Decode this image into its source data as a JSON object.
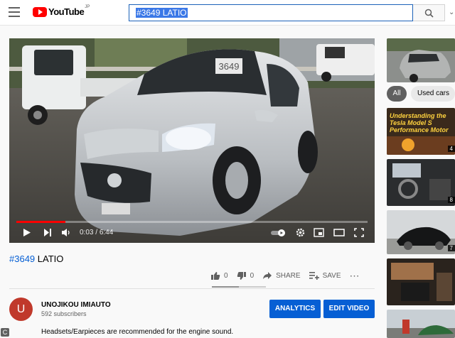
{
  "header": {
    "logo_text": "YouTube",
    "logo_region": "JP",
    "search_query": "#3649 LATIO"
  },
  "player": {
    "current_time": "0:03",
    "separator": " / ",
    "duration": "6:44",
    "progress_fraction": 0.0074,
    "plate_text": "3649"
  },
  "video": {
    "title_hash": "#3649",
    "title_rest": " LATIO",
    "likes": "0",
    "dislikes": "0",
    "share_label": "SHARE",
    "save_label": "SAVE",
    "more_label": "⋯"
  },
  "channel": {
    "avatar_letter": "U",
    "name": "UNOJIKOU IMIAUTO",
    "subscribers": "592 subscribers",
    "analytics_label": "ANALYTICS",
    "edit_label": "EDIT VIDEO"
  },
  "description": "Headsets/Earpieces are recommended for the engine sound.",
  "corner_badge": "C",
  "sidebar": {
    "chips": [
      "All",
      "Used cars"
    ],
    "thumb_title_text": "Understanding the Tesla Model S Performance Motor",
    "badges": [
      "4",
      "8",
      "7"
    ]
  },
  "colors": {
    "brand_red": "#ff0000",
    "link_blue": "#065fd4",
    "button_blue": "#065fd4",
    "avatar_red": "#c0392b"
  }
}
